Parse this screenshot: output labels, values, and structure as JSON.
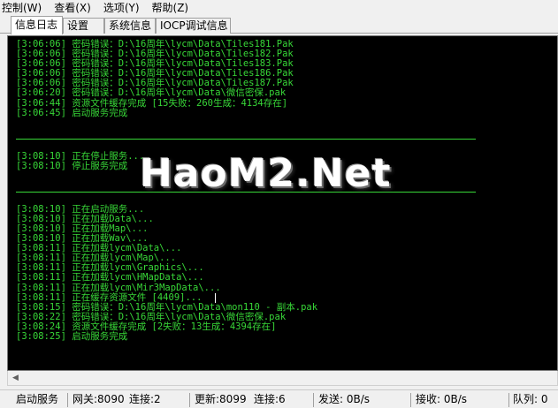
{
  "menu": [
    "控制(W)",
    "查看(X)",
    "选项(Y)",
    "帮助(Z)"
  ],
  "tabs": [
    "信息日志",
    "设置",
    "系统信息",
    "IOCP调试信息"
  ],
  "log": [
    "[3:06:06] 密码错误：D:\\16周年\\lycm\\Data\\Tiles181.Pak",
    "[3:06:06] 密码错误：D:\\16周年\\lycm\\Data\\Tiles182.Pak",
    "[3:06:06] 密码错误：D:\\16周年\\lycm\\Data\\Tiles183.Pak",
    "[3:06:06] 密码错误：D:\\16周年\\lycm\\Data\\Tiles186.Pak",
    "[3:06:06] 密码错误：D:\\16周年\\lycm\\Data\\Tiles187.Pak",
    "[3:06:20] 密码错误：D:\\16周年\\lycm\\Data\\微信密保.pak",
    "[3:06:44] 资源文件缓存完成 [15失败：260生成：4134存在]",
    "[3:06:45] 启动服务完成",
    "[3:08:10] 正在停止服务...",
    "[3:08:10] 停止服务完成",
    "[3:08:10] 正在启动服务...",
    "[3:08:10] 正在加载Data\\...",
    "[3:08:10] 正在加载Map\\...",
    "[3:08:10] 正在加载Wav\\...",
    "[3:08:11] 正在加载lycm\\Data\\...",
    "[3:08:11] 正在加载lycm\\Map\\...",
    "[3:08:11] 正在加载lycm\\Graphics\\...",
    "[3:08:11] 正在加载lycm\\HMapData\\...",
    "[3:08:11] 正在加载lycm\\Mir3MapData\\...",
    "[3:08:11] 正在缓存资源文件 [4409]...",
    "[3:08:15] 密码错误：D:\\16周年\\lycm\\Data\\mon110 - 副本.pak",
    "[3:08:22] 密码错误：D:\\16周年\\lycm\\Data\\微信密保.pak",
    "[3:08:24] 资源文件缓存完成 [2失败：13生成：4394存在]",
    "[3:08:25] 启动服务完成"
  ],
  "watermark": "HaoM2.Net",
  "status": {
    "service": "启动服务",
    "gateway": "网关:8090",
    "gateway_conn": "连接:2",
    "update": "更新:8099",
    "update_conn": "连接:6",
    "send": "发送: 0B/s",
    "recv": "接收: 0B/s",
    "queue": "队列: 0"
  },
  "colors": {
    "log_text": "#38d838",
    "console_bg": "#000000"
  }
}
